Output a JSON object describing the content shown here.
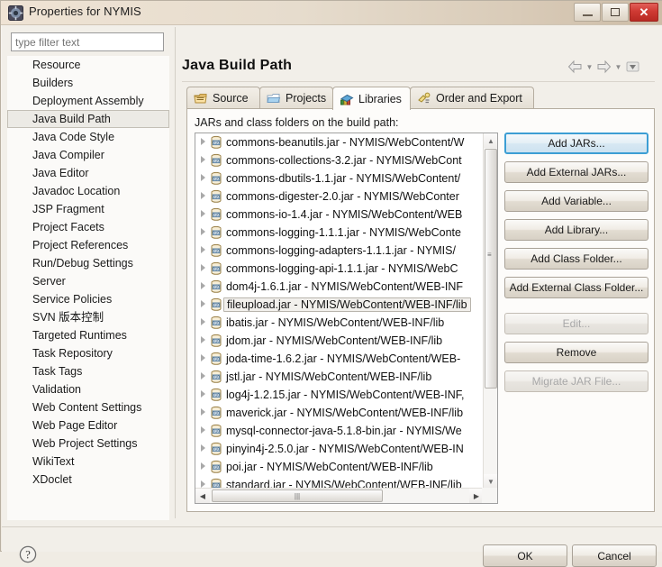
{
  "window": {
    "title": "Properties for NYMIS",
    "icon": "eclipse-properties-icon",
    "minimize_label": "",
    "maximize_label": "",
    "close_label": "✕"
  },
  "filter": {
    "placeholder": "type filter text",
    "value": ""
  },
  "sidebar": {
    "selected": "Java Build Path",
    "items": [
      {
        "label": "Resource"
      },
      {
        "label": "Builders"
      },
      {
        "label": "Deployment Assembly"
      },
      {
        "label": "Java Build Path"
      },
      {
        "label": "Java Code Style"
      },
      {
        "label": "Java Compiler"
      },
      {
        "label": "Java Editor"
      },
      {
        "label": "Javadoc Location"
      },
      {
        "label": "JSP Fragment"
      },
      {
        "label": "Project Facets"
      },
      {
        "label": "Project References"
      },
      {
        "label": "Run/Debug Settings"
      },
      {
        "label": "Server"
      },
      {
        "label": "Service Policies"
      },
      {
        "label": "SVN 版本控制"
      },
      {
        "label": "Targeted Runtimes"
      },
      {
        "label": "Task Repository"
      },
      {
        "label": "Task Tags"
      },
      {
        "label": "Validation"
      },
      {
        "label": "Web Content Settings"
      },
      {
        "label": "Web Page Editor"
      },
      {
        "label": "Web Project Settings"
      },
      {
        "label": "WikiText"
      },
      {
        "label": "XDoclet"
      }
    ]
  },
  "page": {
    "title": "Java Build Path",
    "nav": {
      "back_icon": "back-arrow-icon",
      "back_menu_icon": "chevron-down-icon",
      "forward_icon": "forward-arrow-icon",
      "forward_menu_icon": "chevron-down-icon",
      "view_menu_icon": "view-menu-icon"
    }
  },
  "tabs": [
    {
      "label": "Source",
      "icon": "source-folder-icon",
      "active": false
    },
    {
      "label": "Projects",
      "icon": "project-folder-icon",
      "active": false
    },
    {
      "label": "Libraries",
      "icon": "libraries-books-icon",
      "active": true
    },
    {
      "label": "Order and Export",
      "icon": "order-export-icon",
      "active": false
    }
  ],
  "libraries": {
    "list_label": "JARs and class folders on the build path:",
    "selected_index": 9,
    "entries": [
      "commons-beanutils.jar - NYMIS/WebContent/W",
      "commons-collections-3.2.jar - NYMIS/WebCont",
      "commons-dbutils-1.1.jar - NYMIS/WebContent/",
      "commons-digester-2.0.jar - NYMIS/WebConter",
      "commons-io-1.4.jar - NYMIS/WebContent/WEB",
      "commons-logging-1.1.1.jar - NYMIS/WebConte",
      "commons-logging-adapters-1.1.1.jar - NYMIS/",
      "commons-logging-api-1.1.1.jar - NYMIS/WebC",
      "dom4j-1.6.1.jar - NYMIS/WebContent/WEB-INF",
      "fileupload.jar - NYMIS/WebContent/WEB-INF/lib",
      "ibatis.jar - NYMIS/WebContent/WEB-INF/lib",
      "jdom.jar - NYMIS/WebContent/WEB-INF/lib",
      "joda-time-1.6.2.jar - NYMIS/WebContent/WEB-",
      "jstl.jar - NYMIS/WebContent/WEB-INF/lib",
      "log4j-1.2.15.jar - NYMIS/WebContent/WEB-INF,",
      "maverick.jar - NYMIS/WebContent/WEB-INF/lib",
      "mysql-connector-java-5.1.8-bin.jar - NYMIS/We",
      "pinyin4j-2.5.0.jar - NYMIS/WebContent/WEB-IN",
      "poi.jar - NYMIS/WebContent/WEB-INF/lib",
      "standard.jar - NYMIS/WebContent/WEB-INF/lib"
    ],
    "buttons": [
      {
        "label": "Add JARs...",
        "state": "primary"
      },
      {
        "label": "Add External JARs...",
        "state": "normal"
      },
      {
        "label": "Add Variable...",
        "state": "normal"
      },
      {
        "label": "Add Library...",
        "state": "normal"
      },
      {
        "label": "Add Class Folder...",
        "state": "normal"
      },
      {
        "label": "Add External Class Folder...",
        "state": "normal"
      },
      {
        "label": "Edit...",
        "state": "disabled"
      },
      {
        "label": "Remove",
        "state": "normal"
      },
      {
        "label": "Migrate JAR File...",
        "state": "disabled"
      }
    ]
  },
  "footer": {
    "help_icon": "help-question-icon",
    "ok_label": "OK",
    "cancel_label": "Cancel"
  },
  "colors": {
    "accent": "#3c9ed4",
    "titlebar": "#e6dccd",
    "close_button": "#cf3a33",
    "selection_bg": "#f2f0ec"
  }
}
